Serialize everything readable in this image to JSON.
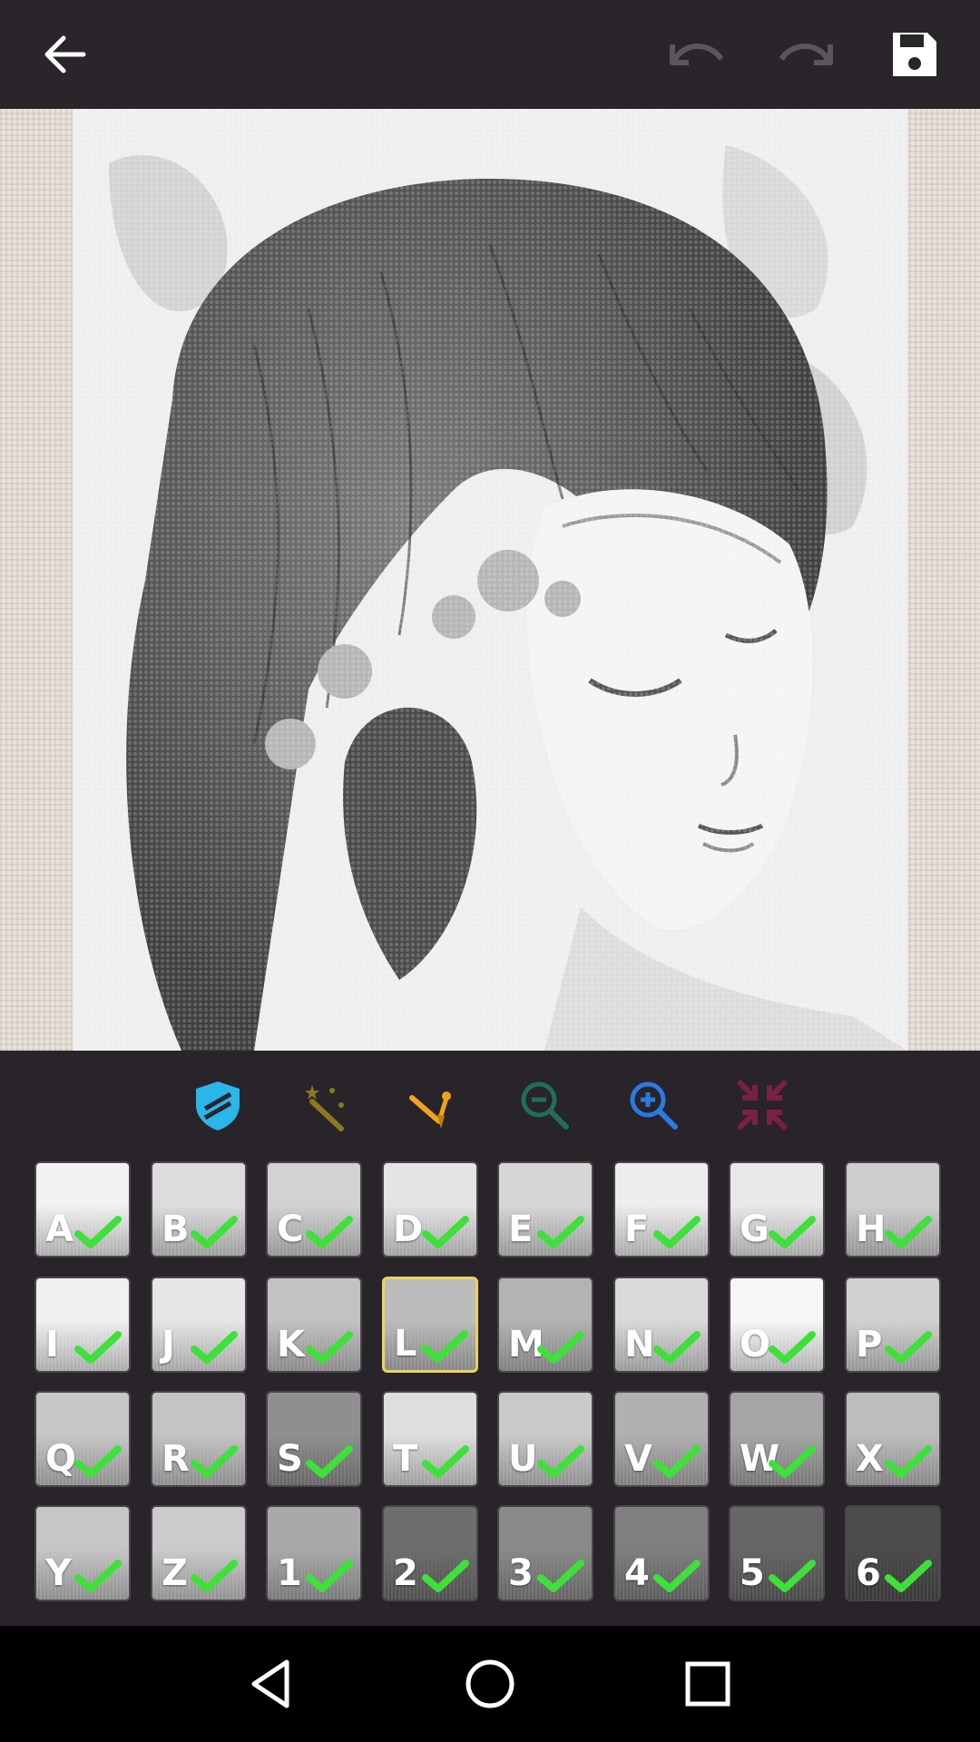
{
  "topbar": {
    "back_icon": "arrow-left-icon",
    "undo_icon": "undo-icon",
    "redo_icon": "redo-icon",
    "save_icon": "save-icon"
  },
  "tools": [
    {
      "icon": "shield-icon",
      "color": "#29b6e8"
    },
    {
      "icon": "magic-wand-icon",
      "color": "#8a7a1e"
    },
    {
      "icon": "needle-icon",
      "color": "#f0a21a"
    },
    {
      "icon": "zoom-out-icon",
      "color": "#1f6e5a"
    },
    {
      "icon": "zoom-in-icon",
      "color": "#2a7ae0"
    },
    {
      "icon": "collapse-icon",
      "color": "#7a1f48"
    }
  ],
  "palette": {
    "selected": "L",
    "rows": [
      [
        {
          "label": "A",
          "tone": "#f2f2f2"
        },
        {
          "label": "B",
          "tone": "#dcdcdc"
        },
        {
          "label": "C",
          "tone": "#d2d2d2"
        },
        {
          "label": "D",
          "tone": "#e4e4e4"
        },
        {
          "label": "E",
          "tone": "#d6d6d6"
        },
        {
          "label": "F",
          "tone": "#ededed"
        },
        {
          "label": "G",
          "tone": "#e9e9e9"
        },
        {
          "label": "H",
          "tone": "#cfcfcf"
        }
      ],
      [
        {
          "label": "I",
          "tone": "#f0f0f0"
        },
        {
          "label": "J",
          "tone": "#e7e7e7"
        },
        {
          "label": "K",
          "tone": "#c2c2c2"
        },
        {
          "label": "L",
          "tone": "#bcbcbc"
        },
        {
          "label": "M",
          "tone": "#b3b3b3"
        },
        {
          "label": "N",
          "tone": "#d9d9d9"
        },
        {
          "label": "O",
          "tone": "#f7f7f7"
        },
        {
          "label": "P",
          "tone": "#d1d1d1"
        }
      ],
      [
        {
          "label": "Q",
          "tone": "#c7c7c7"
        },
        {
          "label": "R",
          "tone": "#c4c4c4"
        },
        {
          "label": "S",
          "tone": "#8f8f8f"
        },
        {
          "label": "T",
          "tone": "#dedede"
        },
        {
          "label": "U",
          "tone": "#c9c9c9"
        },
        {
          "label": "V",
          "tone": "#b0b0b0"
        },
        {
          "label": "W",
          "tone": "#a5a5a5"
        },
        {
          "label": "X",
          "tone": "#bdbdbd"
        }
      ],
      [
        {
          "label": "Y",
          "tone": "#c6c6c6"
        },
        {
          "label": "Z",
          "tone": "#cbcbcb"
        },
        {
          "label": "1",
          "tone": "#a9a9a9"
        },
        {
          "label": "2",
          "tone": "#6e6e6e"
        },
        {
          "label": "3",
          "tone": "#8a8a8a"
        },
        {
          "label": "4",
          "tone": "#7f7f7f"
        },
        {
          "label": "5",
          "tone": "#666666"
        },
        {
          "label": "6",
          "tone": "#4c4c4c"
        }
      ]
    ]
  },
  "navbar": {
    "back_icon": "nav-back-icon",
    "home_icon": "nav-home-icon",
    "recents_icon": "nav-recents-icon"
  },
  "colors": {
    "check": "#3ee03a",
    "selected_border": "#ecd35a"
  }
}
